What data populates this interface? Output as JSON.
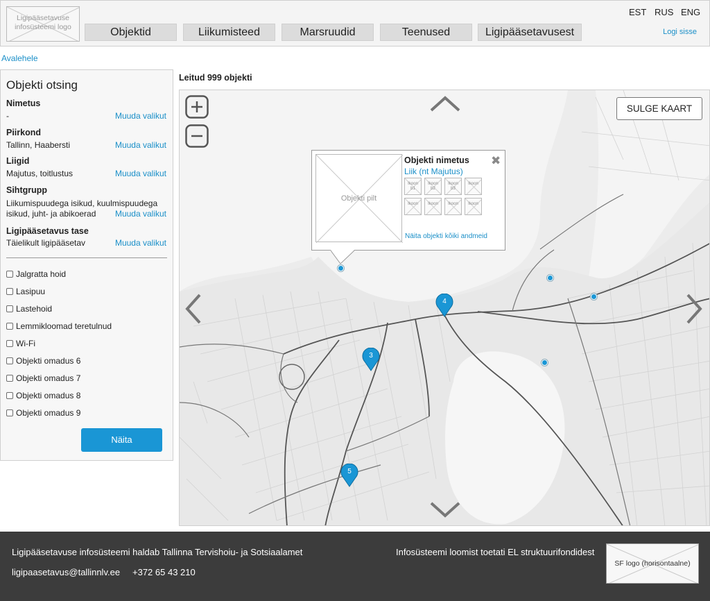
{
  "header": {
    "logo_text": "Ligipääsetavuse infosüsteemi logo",
    "nav": [
      "Objektid",
      "Liikumisteed",
      "Marsruudid",
      "Teenused",
      "Ligipääsetavusest"
    ],
    "languages": [
      "EST",
      "RUS",
      "ENG"
    ],
    "login": "Logi sisse"
  },
  "breadcrumb": "Avalehele",
  "sidebar": {
    "title": "Objekti otsing",
    "filters": [
      {
        "label": "Nimetus",
        "value": "-",
        "change": "Muuda valikut"
      },
      {
        "label": "Piirkond",
        "value": "Tallinn, Haabersti",
        "change": "Muuda valikut"
      },
      {
        "label": "Liigid",
        "value": "Majutus, toitlustus",
        "change": "Muuda valikut"
      },
      {
        "label": "Sihtgrupp",
        "value": "Liikumispuudega isikud, kuulmispuudega isikud, juht- ja abikoerad",
        "change": "Muuda valikut"
      },
      {
        "label": "Ligipääsetavus tase",
        "value": "Täielikult ligipääsetav",
        "change": "Muuda valikut"
      }
    ],
    "options": [
      "Jalgratta hoid",
      "Lasipuu",
      "Lastehoid",
      "Lemmikloomad teretulnud",
      "Wi-Fi",
      "Objekti omadus 6",
      "Objekti  omadus 7",
      "Objekti  omadus 8",
      "Objekti  omadus 9"
    ],
    "show_button": "Näita"
  },
  "results_text": "Leitud 999 objekti",
  "map": {
    "close_button": "SULGE KAART",
    "popup": {
      "image_text": "Objekti pilt",
      "name": "Objekti nimetus",
      "type": "Liik (nt Majutus)",
      "icons": [
        "Ikoon b1",
        "Ikoon b2",
        "Ikoon b3",
        "Ikoon",
        "Ikoon",
        "Ikoon",
        "Ikoon",
        "Ikoon"
      ],
      "link": "Näita objekti kõiki andmeid"
    },
    "markers": [
      "4",
      "3",
      "5"
    ]
  },
  "footer": {
    "maintainer": "Ligipääsetavuse infosüsteemi haldab Tallinna Tervishoiu- ja Sotsiaalamet",
    "email": "ligipaasetavus@tallinnlv.ee",
    "phone": "+372 65 43 210",
    "funding": "Infosüsteemi loomist toetati EL struktuurifondidest",
    "sf_logo": "SF logo (horisontaalne)"
  },
  "colors": {
    "accent": "#1a96d5",
    "link": "#1a8fc8",
    "footer_bg": "#3c3c3c"
  }
}
